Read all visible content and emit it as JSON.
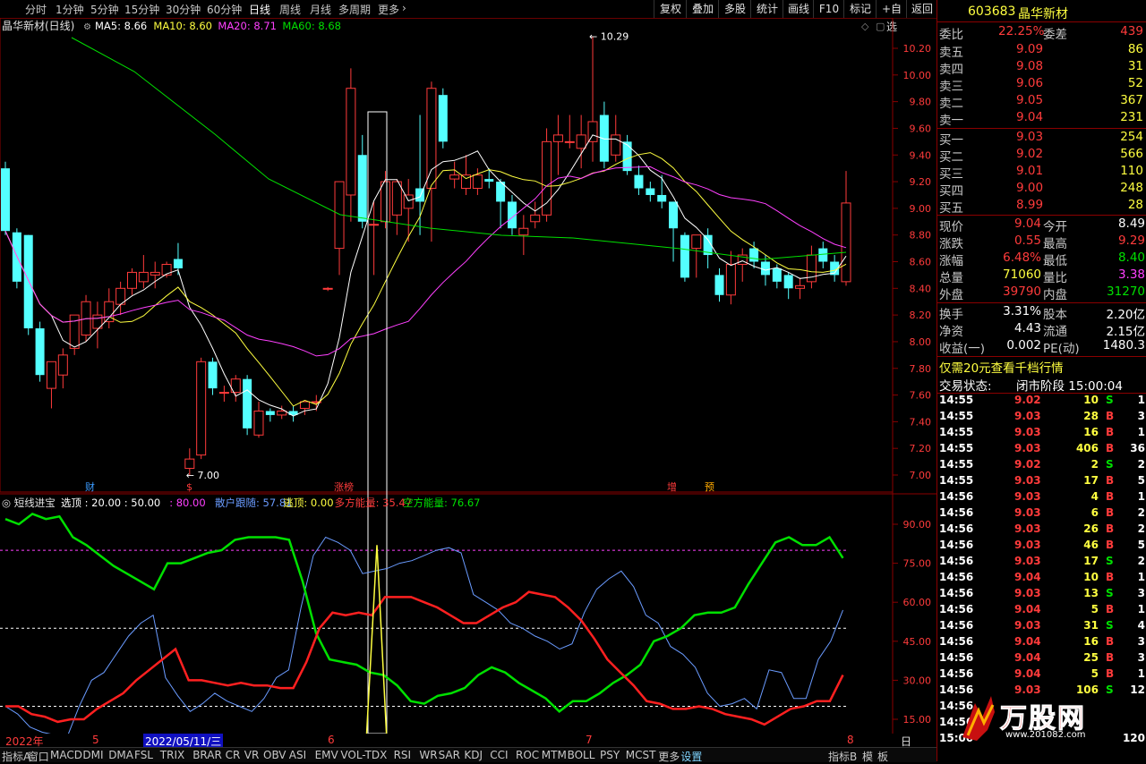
{
  "toolbar": {
    "periods": [
      "分时",
      "1分钟",
      "5分钟",
      "15分钟",
      "30分钟",
      "60分钟",
      "日线",
      "周线",
      "月线",
      "多周期",
      "更多"
    ],
    "active_period": "日线",
    "more_arrow": "›",
    "right_buttons": [
      "复权",
      "叠加",
      "多股",
      "统计",
      "画线",
      "F10",
      "标记",
      "+自选",
      "返回"
    ]
  },
  "main_chart": {
    "title": "晶华新材(日线)",
    "ma_labels": [
      {
        "text": "MA5: 8.66",
        "color": "#ffffff"
      },
      {
        "text": "MA10: 8.60",
        "color": "#ffff40"
      },
      {
        "text": "MA20: 8.71",
        "color": "#ff40ff"
      },
      {
        "text": "MA60: 8.68",
        "color": "#00e000"
      }
    ],
    "price_ticks": [
      "10.20",
      "10.00",
      "9.80",
      "9.60",
      "9.40",
      "9.20",
      "9.00",
      "8.80",
      "8.60",
      "8.40",
      "8.20",
      "8.00",
      "7.80",
      "7.60",
      "7.40",
      "7.20",
      "7.00"
    ],
    "high_label": "10.29",
    "low_label": "7.00",
    "event_marks": [
      {
        "text": "财",
        "color": "#3b9bff"
      },
      {
        "text": "$",
        "color": "#ff3b3b"
      },
      {
        "text": "涨榜",
        "color": "#ff3b3b"
      },
      {
        "text": "增",
        "color": "#ff3b3b"
      },
      {
        "text": "预",
        "color": "#ffaa00"
      }
    ],
    "candles": [
      [
        9.3,
        8.83,
        9.35,
        8.8
      ],
      [
        8.82,
        8.45,
        8.85,
        8.4
      ],
      [
        8.8,
        8.1,
        8.8,
        8.05
      ],
      [
        8.1,
        7.75,
        8.15,
        7.7
      ],
      [
        7.65,
        7.85,
        7.85,
        7.5
      ],
      [
        7.75,
        7.9,
        7.95,
        7.65
      ],
      [
        7.95,
        8.2,
        8.2,
        7.9
      ],
      [
        8.05,
        8.3,
        8.35,
        8.0
      ],
      [
        8.1,
        8.2,
        8.3,
        7.95
      ],
      [
        8.15,
        8.3,
        8.4,
        8.1
      ],
      [
        8.28,
        8.4,
        8.45,
        8.2
      ],
      [
        8.4,
        8.52,
        8.55,
        8.35
      ],
      [
        8.45,
        8.52,
        8.65,
        8.4
      ],
      [
        8.5,
        8.52,
        8.6,
        8.4
      ],
      [
        8.5,
        8.58,
        8.6,
        8.48
      ],
      [
        8.62,
        8.55,
        8.74,
        8.5
      ],
      [
        7.05,
        7.12,
        7.2,
        7.0
      ],
      [
        7.15,
        7.85,
        7.88,
        7.12
      ],
      [
        7.85,
        7.65,
        7.88,
        7.6
      ],
      [
        7.62,
        7.62,
        7.67,
        7.55
      ],
      [
        7.62,
        7.72,
        7.75,
        7.55
      ],
      [
        7.72,
        7.35,
        7.75,
        7.3
      ],
      [
        7.3,
        7.48,
        7.55,
        7.28
      ],
      [
        7.48,
        7.45,
        7.5,
        7.4
      ],
      [
        7.45,
        7.48,
        7.52,
        7.42
      ],
      [
        7.48,
        7.45,
        7.52,
        7.4
      ],
      [
        7.5,
        7.55,
        7.55,
        7.45
      ],
      [
        7.55,
        7.55,
        7.6,
        7.48
      ],
      [
        8.4,
        8.4,
        8.41,
        8.38
      ],
      [
        8.7,
        9.2,
        9.2,
        8.5
      ],
      [
        9.1,
        9.9,
        10.05,
        8.9
      ],
      [
        9.4,
        8.9,
        9.55,
        8.85
      ],
      [
        8.88,
        8.88,
        9.05,
        8.5
      ],
      [
        8.9,
        9.2,
        9.28,
        8.85
      ],
      [
        8.95,
        9.2,
        9.22,
        8.8
      ],
      [
        9.0,
        9.1,
        9.22,
        8.75
      ],
      [
        9.15,
        9.05,
        9.7,
        8.8
      ],
      [
        9.15,
        9.9,
        9.95,
        8.75
      ],
      [
        9.85,
        9.5,
        9.9,
        9.45
      ],
      [
        9.22,
        9.25,
        9.35,
        9.15
      ],
      [
        9.15,
        9.25,
        9.4,
        9.1
      ],
      [
        9.15,
        9.25,
        9.3,
        9.1
      ],
      [
        9.22,
        9.2,
        9.3,
        9.15
      ],
      [
        9.2,
        9.05,
        9.22,
        8.85
      ],
      [
        9.05,
        8.85,
        9.1,
        8.8
      ],
      [
        8.8,
        8.85,
        8.95,
        8.65
      ],
      [
        8.9,
        8.95,
        9.05,
        8.85
      ],
      [
        8.95,
        9.5,
        9.6,
        8.9
      ],
      [
        9.5,
        9.55,
        9.7,
        9.25
      ],
      [
        9.5,
        9.5,
        9.7,
        9.45
      ],
      [
        9.45,
        9.55,
        9.7,
        9.3
      ],
      [
        9.5,
        9.65,
        10.29,
        9.35
      ],
      [
        9.7,
        9.35,
        9.8,
        9.3
      ],
      [
        9.4,
        9.55,
        9.7,
        9.35
      ],
      [
        9.5,
        9.28,
        9.55,
        9.25
      ],
      [
        9.25,
        9.15,
        9.32,
        9.1
      ],
      [
        9.15,
        9.1,
        9.2,
        9.05
      ],
      [
        9.1,
        9.05,
        9.25,
        9.0
      ],
      [
        9.05,
        8.85,
        9.05,
        8.6
      ],
      [
        8.8,
        8.48,
        8.82,
        8.45
      ],
      [
        8.7,
        8.8,
        8.8,
        8.48
      ],
      [
        8.8,
        8.65,
        8.85,
        8.55
      ],
      [
        8.5,
        8.35,
        8.55,
        8.3
      ],
      [
        8.35,
        8.58,
        8.68,
        8.28
      ],
      [
        8.58,
        8.65,
        8.7,
        8.45
      ],
      [
        8.7,
        8.6,
        8.75,
        8.55
      ],
      [
        8.6,
        8.5,
        8.65,
        8.42
      ],
      [
        8.55,
        8.45,
        8.58,
        8.4
      ],
      [
        8.5,
        8.4,
        8.52,
        8.32
      ],
      [
        8.4,
        8.42,
        8.48,
        8.32
      ],
      [
        8.45,
        8.65,
        8.72,
        8.4
      ],
      [
        8.7,
        8.6,
        8.75,
        8.55
      ],
      [
        8.6,
        8.5,
        8.65,
        8.45
      ],
      [
        8.45,
        9.04,
        9.28,
        8.42
      ]
    ]
  },
  "indicator": {
    "title": "短线进宝",
    "labels": [
      {
        "text": "选顶 : 20.00 : 50.00",
        "color": "#ffffff"
      },
      {
        "text": ": 80.00",
        "color": "#ff40ff"
      },
      {
        "text": "散户跟随: 57.81",
        "color": "#6a9bff"
      },
      {
        "text": "逃顶: 0.00",
        "color": "#ffff40"
      },
      {
        "text": "多方能量: 35.47",
        "color": "#ff3b3b"
      },
      {
        "text": "空方能量: 76.67",
        "color": "#00e000"
      }
    ],
    "ticks": [
      "90.00",
      "75.00",
      "60.00",
      "45.00",
      "30.00",
      "15.00"
    ],
    "green_values": [
      92,
      90,
      94,
      92,
      93,
      85,
      82,
      78,
      74,
      71,
      68,
      65,
      75,
      75,
      77,
      79,
      80,
      84,
      85,
      85,
      85,
      84,
      68,
      48,
      38,
      37,
      36,
      33,
      32,
      28,
      22,
      21,
      24,
      25,
      27,
      32,
      35,
      33,
      29,
      26,
      23,
      18,
      22,
      22,
      25,
      29,
      32,
      36,
      45,
      47,
      50,
      55,
      56,
      56,
      58,
      67,
      75,
      83,
      85,
      82,
      82,
      85,
      77
    ],
    "red_values": [
      20,
      20,
      17,
      16,
      14,
      15,
      15,
      19,
      22,
      25,
      30,
      34,
      38,
      42,
      30,
      30,
      29,
      28,
      29,
      28,
      28,
      27,
      27,
      37,
      50,
      56,
      55,
      56,
      55,
      62,
      62,
      62,
      60,
      58,
      55,
      52,
      52,
      55,
      58,
      60,
      64,
      63,
      62,
      58,
      53,
      46,
      38,
      33,
      28,
      22,
      21,
      19,
      19,
      20,
      19,
      17,
      16,
      15,
      13,
      16,
      19,
      20,
      22,
      22,
      32
    ],
    "blue_values": [
      20,
      17,
      12,
      10,
      9,
      8,
      20,
      30,
      33,
      40,
      47,
      52,
      55,
      31,
      24,
      18,
      21,
      25,
      22,
      20,
      18,
      23,
      31,
      34,
      58,
      78,
      85,
      83,
      80,
      71,
      72,
      73,
      75,
      76,
      78,
      80,
      81,
      79,
      63,
      60,
      57,
      52,
      50,
      47,
      45,
      42,
      44,
      56,
      65,
      69,
      72,
      66,
      55,
      52,
      43,
      40,
      35,
      25,
      20,
      21,
      23,
      19,
      34,
      33,
      23,
      23,
      38,
      45,
      57
    ],
    "yellow_spike": {
      "before": 0,
      "peak": 82,
      "after": 0
    }
  },
  "date_axis": {
    "labels": [
      "2022年",
      "5",
      "2022/05/11/三",
      "6",
      "7",
      "8"
    ],
    "right_label": "日线"
  },
  "bottom_tabs": [
    "指标A",
    "窗口",
    "MACD",
    "DMI",
    "DMA",
    "FSL",
    "TRIX",
    "BRAR",
    "CR",
    "VR",
    "OBV",
    "ASI",
    "EMV",
    "VOL-TDX",
    "RSI",
    "WR",
    "SAR",
    "KDJ",
    "CCI",
    "ROC",
    "MTM",
    "BOLL",
    "PSY",
    "MCST",
    "更多",
    "设置",
    "指标B",
    "模",
    "板"
  ],
  "quote": {
    "code": "603683",
    "name": "晶华新材",
    "webi_label": "委比",
    "webi_value": "22.25%",
    "weicha_label": "委差",
    "weicha_value": "439",
    "sell": [
      {
        "label": "卖五",
        "price": "9.09",
        "vol": "86"
      },
      {
        "label": "卖四",
        "price": "9.08",
        "vol": "31"
      },
      {
        "label": "卖三",
        "price": "9.06",
        "vol": "52"
      },
      {
        "label": "卖二",
        "price": "9.05",
        "vol": "367"
      },
      {
        "label": "卖一",
        "price": "9.04",
        "vol": "231"
      }
    ],
    "buy": [
      {
        "label": "买一",
        "price": "9.03",
        "vol": "254"
      },
      {
        "label": "买二",
        "price": "9.02",
        "vol": "566"
      },
      {
        "label": "买三",
        "price": "9.01",
        "vol": "110"
      },
      {
        "label": "买四",
        "price": "9.00",
        "vol": "248"
      },
      {
        "label": "买五",
        "price": "8.99",
        "vol": "28"
      }
    ],
    "stats": [
      {
        "l1": "现价",
        "v1": "9.04",
        "c1": "red",
        "l2": "今开",
        "v2": "8.49",
        "c2": "white"
      },
      {
        "l1": "涨跌",
        "v1": "0.55",
        "c1": "red",
        "l2": "最高",
        "v2": "9.29",
        "c2": "red"
      },
      {
        "l1": "涨幅",
        "v1": "6.48%",
        "c1": "red",
        "l2": "最低",
        "v2": "8.40",
        "c2": "green"
      },
      {
        "l1": "总量",
        "v1": "71060",
        "c1": "yellow",
        "l2": "量比",
        "v2": "3.38",
        "c2": "mag"
      },
      {
        "l1": "外盘",
        "v1": "39790",
        "c1": "red",
        "l2": "内盘",
        "v2": "31270",
        "c2": "green"
      }
    ],
    "stats2": [
      {
        "l1": "换手",
        "v1": "3.31%",
        "l2": "股本",
        "v2": "2.20亿"
      },
      {
        "l1": "净资",
        "v1": "4.43",
        "l2": "流通",
        "v2": "2.15亿"
      },
      {
        "l1": "收益(一)",
        "v1": "0.002",
        "l2": "PE(动)",
        "v2": "1480.3"
      }
    ],
    "promo": "仅需20元查看千档行情",
    "status_label": "交易状态:",
    "status_value": "闭市阶段 15:00:04"
  },
  "ticks": [
    {
      "t": "14:55",
      "p": "9.02",
      "v": "10",
      "s": "S",
      "n": "1"
    },
    {
      "t": "14:55",
      "p": "9.03",
      "v": "28",
      "s": "B",
      "n": "3"
    },
    {
      "t": "14:55",
      "p": "9.03",
      "v": "16",
      "s": "B",
      "n": "1"
    },
    {
      "t": "14:55",
      "p": "9.03",
      "v": "406",
      "s": "B",
      "n": "36"
    },
    {
      "t": "14:55",
      "p": "9.02",
      "v": "2",
      "s": "S",
      "n": "2"
    },
    {
      "t": "14:55",
      "p": "9.03",
      "v": "17",
      "s": "B",
      "n": "5"
    },
    {
      "t": "14:56",
      "p": "9.03",
      "v": "4",
      "s": "B",
      "n": "1"
    },
    {
      "t": "14:56",
      "p": "9.03",
      "v": "6",
      "s": "B",
      "n": "2"
    },
    {
      "t": "14:56",
      "p": "9.03",
      "v": "26",
      "s": "B",
      "n": "2"
    },
    {
      "t": "14:56",
      "p": "9.03",
      "v": "46",
      "s": "B",
      "n": "5"
    },
    {
      "t": "14:56",
      "p": "9.03",
      "v": "17",
      "s": "S",
      "n": "2"
    },
    {
      "t": "14:56",
      "p": "9.04",
      "v": "10",
      "s": "B",
      "n": "1"
    },
    {
      "t": "14:56",
      "p": "9.03",
      "v": "13",
      "s": "S",
      "n": "3"
    },
    {
      "t": "14:56",
      "p": "9.04",
      "v": "5",
      "s": "B",
      "n": "1"
    },
    {
      "t": "14:56",
      "p": "9.03",
      "v": "31",
      "s": "S",
      "n": "4"
    },
    {
      "t": "14:56",
      "p": "9.04",
      "v": "16",
      "s": "B",
      "n": "3"
    },
    {
      "t": "14:56",
      "p": "9.04",
      "v": "25",
      "s": "B",
      "n": "3"
    },
    {
      "t": "14:56",
      "p": "9.04",
      "v": "5",
      "s": "B",
      "n": "1"
    },
    {
      "t": "14:56",
      "p": "9.03",
      "v": "106",
      "s": "S",
      "n": "12"
    },
    {
      "t": "14:56",
      "p": "",
      "v": "",
      "s": "",
      "n": ""
    },
    {
      "t": "14:56",
      "p": "",
      "v": "",
      "s": "",
      "n": ""
    },
    {
      "t": "15:00",
      "p": "",
      "v": "",
      "s": "",
      "n": "120"
    }
  ],
  "watermark": {
    "text": "万股网",
    "url": "www.201082.com"
  },
  "colors": {
    "up": "#ff3b3b",
    "down": "#54ffff",
    "grid": "#8b0000",
    "ma5": "#ffffff",
    "ma10": "#ffff40",
    "ma20": "#ff40ff",
    "ma60": "#00e000"
  }
}
